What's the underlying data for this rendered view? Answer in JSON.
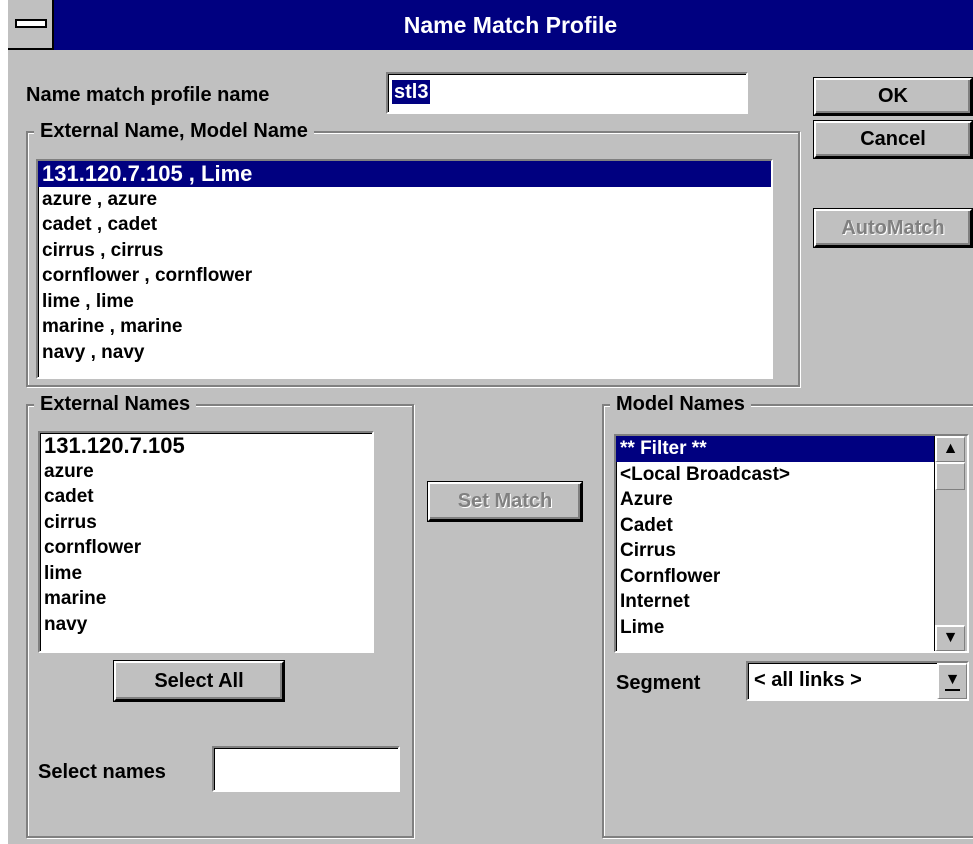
{
  "window": {
    "title": "Name Match Profile"
  },
  "profile": {
    "label": "Name match profile name",
    "value": "stl3"
  },
  "buttons": {
    "ok": "OK",
    "cancel": "Cancel",
    "automatch": "AutoMatch",
    "set_match": "Set Match",
    "select_all": "Select All"
  },
  "pairs": {
    "legend": "External Name, Model Name",
    "items": [
      "131.120.7.105 , Lime",
      "azure , azure",
      "cadet , cadet",
      "cirrus , cirrus",
      "cornflower , cornflower",
      "lime , lime",
      "marine , marine",
      "navy , navy"
    ],
    "selected_index": 0
  },
  "external_names": {
    "legend": "External Names",
    "items": [
      "131.120.7.105",
      "azure",
      "cadet",
      "cirrus",
      "cornflower",
      "lime",
      "marine",
      "navy"
    ]
  },
  "select_names": {
    "label": "Select names",
    "value": ""
  },
  "model_names": {
    "legend": "Model Names",
    "items": [
      "** Filter **",
      "<Local Broadcast>",
      "Azure",
      "Cadet",
      "Cirrus",
      "Cornflower",
      "Internet",
      "Lime"
    ],
    "selected_index": 0
  },
  "segment": {
    "label": "Segment",
    "value": "< all links >"
  },
  "icons": {
    "system_menu": "system-menu-icon",
    "scroll_up": "up-arrow-icon",
    "scroll_down": "down-arrow-icon",
    "dropdown": "dropdown-arrow-icon"
  },
  "colors": {
    "titlebar": "#000080",
    "face": "#c0c0c0",
    "selection": "#000080"
  }
}
